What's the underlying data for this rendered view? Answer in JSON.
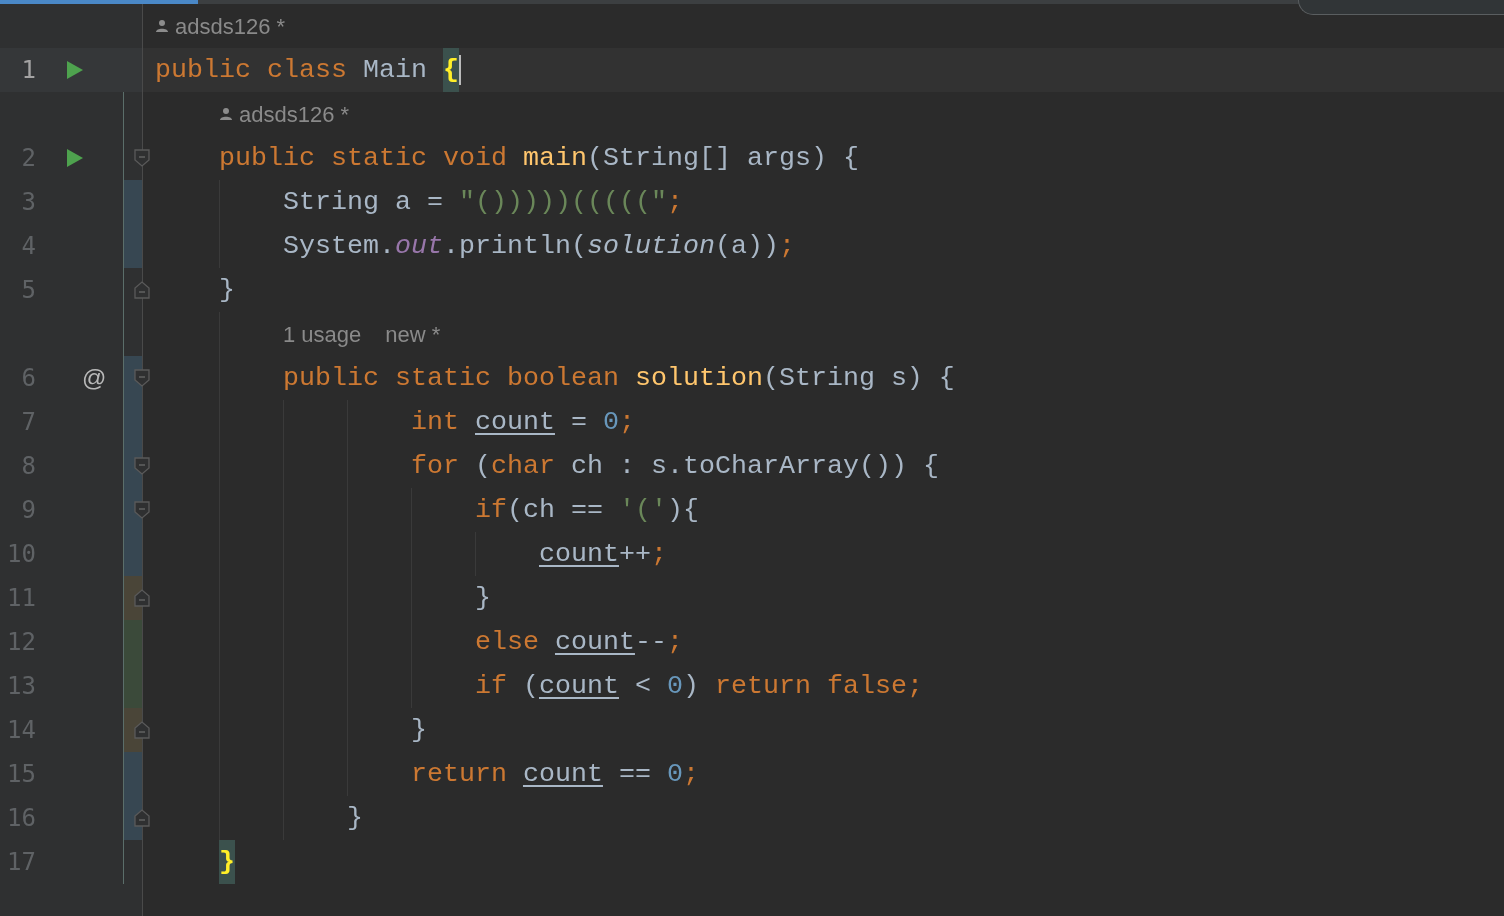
{
  "lines": [
    {
      "kind": "author-hint",
      "texts": [
        "adsds126 *"
      ]
    },
    {
      "kind": "code",
      "number": "1",
      "caret": true,
      "gutter": {
        "kind": "run"
      },
      "tokens": [
        {
          "kind": "keyword",
          "text": "public class "
        },
        {
          "kind": "plain",
          "text": "Main "
        },
        {
          "kind": "brace-match",
          "text": "{"
        }
      ]
    },
    {
      "kind": "author-hint",
      "texts": [
        "adsds126 *"
      ]
    },
    {
      "kind": "code",
      "number": "2",
      "caret": false,
      "gutter": {
        "kind": "run"
      },
      "fold": {
        "kind": "start"
      },
      "tokens": [
        {
          "kind": "keyword",
          "text": "    public static void "
        },
        {
          "kind": "method",
          "text": "main"
        },
        {
          "kind": "plain",
          "text": "(String[] args) {"
        }
      ]
    },
    {
      "kind": "code",
      "number": "3",
      "caret": false,
      "color": "#374752",
      "tokens": [
        {
          "kind": "plain",
          "text": "        String a = "
        },
        {
          "kind": "string",
          "text": "\"()))))(((((\""
        },
        {
          "kind": "keyword",
          "text": ";"
        }
      ]
    },
    {
      "kind": "code",
      "number": "4",
      "caret": false,
      "color": "#374752",
      "tokens": [
        {
          "kind": "plain",
          "text": "        System."
        },
        {
          "kind": "field",
          "text": "out"
        },
        {
          "kind": "plain",
          "text": ".println("
        },
        {
          "kind": "call",
          "text": "solution"
        },
        {
          "kind": "plain",
          "text": "(a))"
        },
        {
          "kind": "keyword",
          "text": ";"
        }
      ]
    },
    {
      "kind": "code",
      "number": "5",
      "caret": false,
      "fold": {
        "kind": "end"
      },
      "tokens": [
        {
          "kind": "plain",
          "text": "    }"
        }
      ]
    },
    {
      "kind": "usage-hint",
      "texts": [
        "1 usage",
        "new *"
      ]
    },
    {
      "kind": "code",
      "number": "6",
      "caret": false,
      "gutter": {
        "kind": "mark",
        "text": "@"
      },
      "fold": {
        "kind": "start"
      },
      "color": "#374752",
      "tokens": [
        {
          "kind": "keyword",
          "text": "        public static boolean "
        },
        {
          "kind": "method",
          "text": "solution"
        },
        {
          "kind": "plain",
          "text": "(String s) {"
        }
      ]
    },
    {
      "kind": "code",
      "number": "7",
      "caret": false,
      "color": "#374752",
      "tokens": [
        {
          "kind": "keyword",
          "text": "                int "
        },
        {
          "kind": "var",
          "text": "count"
        },
        {
          "kind": "plain",
          "text": " = "
        },
        {
          "kind": "number",
          "text": "0"
        },
        {
          "kind": "keyword",
          "text": ";"
        }
      ]
    },
    {
      "kind": "code",
      "number": "8",
      "caret": false,
      "fold": {
        "kind": "start"
      },
      "color": "#374752",
      "tokens": [
        {
          "kind": "keyword",
          "text": "                for "
        },
        {
          "kind": "plain",
          "text": "("
        },
        {
          "kind": "keyword",
          "text": "char "
        },
        {
          "kind": "plain",
          "text": "ch : s.toCharArray()) {"
        }
      ]
    },
    {
      "kind": "code",
      "number": "9",
      "caret": false,
      "fold": {
        "kind": "start"
      },
      "color": "#374752",
      "tokens": [
        {
          "kind": "keyword",
          "text": "                    if"
        },
        {
          "kind": "plain",
          "text": "(ch == "
        },
        {
          "kind": "string",
          "text": "'('"
        },
        {
          "kind": "plain",
          "text": "){"
        }
      ]
    },
    {
      "kind": "code",
      "number": "10",
      "caret": false,
      "color": "#374752",
      "tokens": [
        {
          "kind": "var",
          "text": "                        count"
        },
        {
          "kind": "plain",
          "text": "++"
        },
        {
          "kind": "keyword",
          "text": ";"
        }
      ]
    },
    {
      "kind": "code",
      "number": "11",
      "caret": false,
      "fold": {
        "kind": "end"
      },
      "color": "#4a4538",
      "tokens": [
        {
          "kind": "plain",
          "text": "                    }"
        }
      ]
    },
    {
      "kind": "code",
      "number": "12",
      "caret": false,
      "color": "#3b4a3a",
      "tokens": [
        {
          "kind": "keyword",
          "text": "                    else "
        },
        {
          "kind": "var",
          "text": "count"
        },
        {
          "kind": "plain",
          "text": "--"
        },
        {
          "kind": "keyword",
          "text": ";"
        }
      ]
    },
    {
      "kind": "code",
      "number": "13",
      "caret": false,
      "color": "#3b4a3a",
      "tokens": [
        {
          "kind": "keyword",
          "text": "                    if "
        },
        {
          "kind": "plain",
          "text": "("
        },
        {
          "kind": "var",
          "text": "count"
        },
        {
          "kind": "plain",
          "text": " < "
        },
        {
          "kind": "number",
          "text": "0"
        },
        {
          "kind": "plain",
          "text": ") "
        },
        {
          "kind": "keyword",
          "text": "return false;"
        }
      ]
    },
    {
      "kind": "code",
      "number": "14",
      "caret": false,
      "fold": {
        "kind": "end"
      },
      "color": "#4a4538",
      "tokens": [
        {
          "kind": "plain",
          "text": "                }"
        }
      ]
    },
    {
      "kind": "code",
      "number": "15",
      "caret": false,
      "color": "#374752",
      "tokens": [
        {
          "kind": "keyword",
          "text": "                return "
        },
        {
          "kind": "var",
          "text": "count"
        },
        {
          "kind": "plain",
          "text": " == "
        },
        {
          "kind": "number",
          "text": "0"
        },
        {
          "kind": "keyword",
          "text": ";"
        }
      ]
    },
    {
      "kind": "code",
      "number": "16",
      "caret": false,
      "fold": {
        "kind": "end"
      },
      "color": "#374752",
      "tokens": [
        {
          "kind": "plain",
          "text": "            }"
        }
      ]
    },
    {
      "kind": "code",
      "number": "17",
      "caret": false,
      "tokens": [
        {
          "kind": "brace-match",
          "text": "    }"
        }
      ]
    }
  ]
}
